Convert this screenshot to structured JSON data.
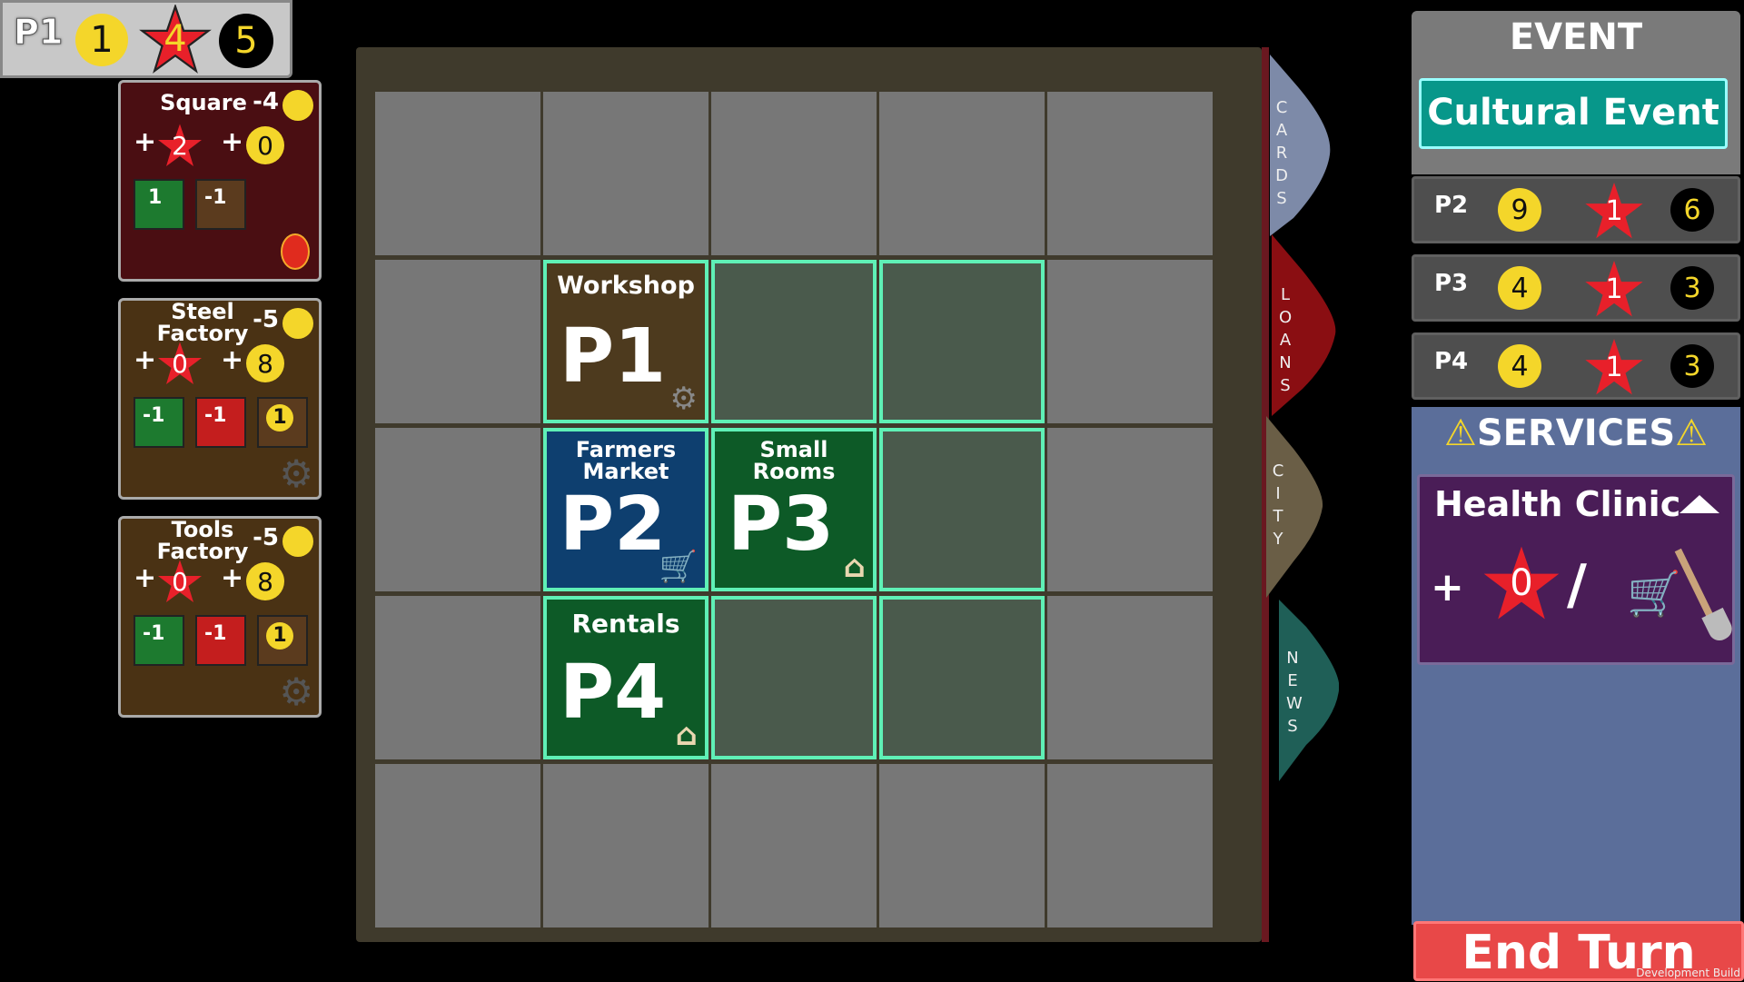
{
  "player_bar": {
    "label": "P1",
    "coins": "1",
    "stars": "4",
    "black": "5"
  },
  "build_cards": [
    {
      "title": "Square",
      "cost": "-4",
      "plus_star": "2",
      "plus_coin": "0",
      "mini": [
        "1",
        "-1"
      ],
      "icon": "lantern-icon"
    },
    {
      "title": "Steel Factory",
      "cost": "-5",
      "plus_star": "0",
      "plus_coin": "8",
      "mini": [
        "-1",
        "-1",
        "1"
      ],
      "icon": "gear-icon"
    },
    {
      "title": "Tools Factory",
      "cost": "-5",
      "plus_star": "0",
      "plus_coin": "8",
      "mini": [
        "-1",
        "-1",
        "1"
      ],
      "icon": "gear-icon"
    }
  ],
  "buildings": [
    {
      "name": "Workshop",
      "player": "P1",
      "color": "#4d3a1e",
      "icon": "gear-icon"
    },
    {
      "name": "Farmers Market",
      "player": "P2",
      "color": "#0e3f6f",
      "icon": "cart-icon"
    },
    {
      "name": "Small Rooms",
      "player": "P3",
      "color": "#0d5a27",
      "icon": "house-icon"
    },
    {
      "name": "Rentals",
      "player": "P4",
      "color": "#0d5a27",
      "icon": "house-icon"
    }
  ],
  "tabs": {
    "cards": "CARDS",
    "loans": "LOANS",
    "city": "CITY",
    "news": "NEWS"
  },
  "event": {
    "header": "EVENT",
    "name": "Cultural Event"
  },
  "players": [
    {
      "label": "P2",
      "coins": "9",
      "stars": "1",
      "black": "6"
    },
    {
      "label": "P3",
      "coins": "4",
      "stars": "1",
      "black": "3"
    },
    {
      "label": "P4",
      "coins": "4",
      "stars": "1",
      "black": "3"
    }
  ],
  "services": {
    "header": "SERVICES",
    "card_title": "Health Clinic",
    "plus": "+",
    "star": "0",
    "slash": "/"
  },
  "end_turn": "End Turn",
  "dev_build": "Development Build",
  "colors": {
    "coin": "#f4d62a",
    "star": "#e8202a",
    "event": "#07978a",
    "highlight": "#5ff0b6"
  }
}
